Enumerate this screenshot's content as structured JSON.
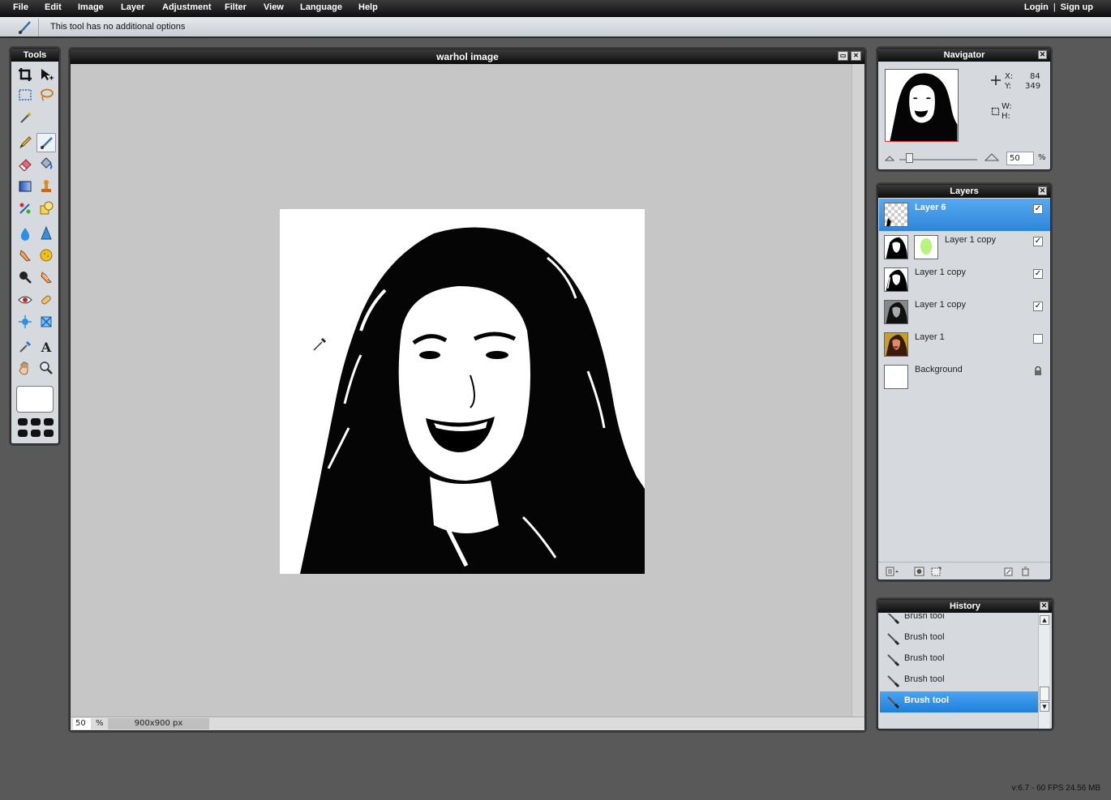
{
  "menu": {
    "items": [
      "File",
      "Edit",
      "Image",
      "Layer",
      "Adjustment",
      "Filter",
      "View",
      "Language",
      "Help"
    ],
    "login": "Login",
    "separator": "|",
    "signup": "Sign up"
  },
  "options_bar": {
    "message": "This tool has no additional options",
    "tool_icon": "brush-icon"
  },
  "tools_panel": {
    "title": "Tools"
  },
  "document": {
    "title": "warhol image",
    "zoom_value": "50",
    "zoom_unit": "%",
    "dimensions": "900x900 px"
  },
  "navigator": {
    "title": "Navigator",
    "x_label": "X:",
    "x_value": "84",
    "y_label": "Y:",
    "y_value": "349",
    "w_label": "W:",
    "h_label": "H:",
    "zoom_value": "50",
    "zoom_unit": "%"
  },
  "layers": {
    "title": "Layers",
    "items": [
      {
        "name": "Layer 6",
        "visible": true,
        "selected": true
      },
      {
        "name": "Layer 1 copy",
        "visible": true,
        "selected": false,
        "has_mask": true
      },
      {
        "name": "Layer 1 copy",
        "visible": true,
        "selected": false
      },
      {
        "name": "Layer 1 copy",
        "visible": true,
        "selected": false
      },
      {
        "name": "Layer 1",
        "visible": false,
        "selected": false
      },
      {
        "name": "Background",
        "locked": true,
        "selected": false
      }
    ],
    "check_glyph": "✓"
  },
  "history": {
    "title": "History",
    "items": [
      {
        "label": "Brush tool",
        "selected": false
      },
      {
        "label": "Brush tool",
        "selected": false
      },
      {
        "label": "Brush tool",
        "selected": false
      },
      {
        "label": "Brush tool",
        "selected": false
      },
      {
        "label": "Brush tool",
        "selected": true
      }
    ]
  },
  "status": {
    "version": "v:6.7 - 60 FPS 24.56 MB"
  },
  "colors": {
    "selection_blue": "#2e86db",
    "panel_bg": "#d6dade",
    "app_bg": "#595959",
    "canvas_bg": "#c6c6c6"
  }
}
